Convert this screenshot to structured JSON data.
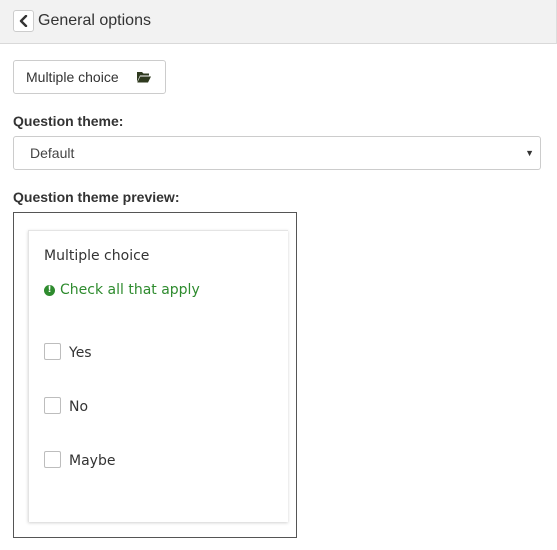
{
  "header": {
    "title": "General options",
    "back_icon": "chevron-left-icon"
  },
  "question_type": {
    "label": "Multiple choice",
    "icon": "folder-open-icon"
  },
  "theme": {
    "label": "Question theme:",
    "selected": "Default"
  },
  "preview": {
    "label": "Question theme preview:",
    "question_title": "Multiple choice",
    "hint": "Check all that apply",
    "hint_color": "#2e8b2e",
    "options": [
      {
        "label": "Yes",
        "checked": false
      },
      {
        "label": "No",
        "checked": false
      },
      {
        "label": "Maybe",
        "checked": false
      }
    ]
  }
}
